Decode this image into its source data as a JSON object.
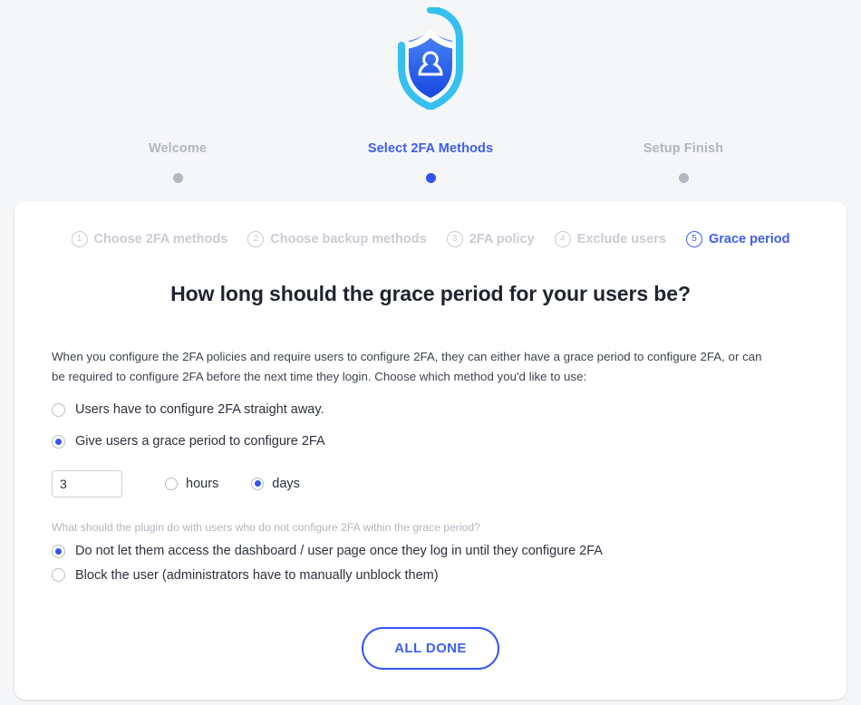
{
  "header": {
    "logo_icon": "shield-user-lock-icon",
    "logo_colors": {
      "outer": "#3ac6f0",
      "inner_top": "#3f7ef5",
      "inner_bottom": "#1e50e6"
    }
  },
  "wizard": {
    "steps": [
      {
        "label": "Welcome",
        "state": "done"
      },
      {
        "label": "Select 2FA Methods",
        "state": "active"
      },
      {
        "label": "Setup Finish",
        "state": "upcoming"
      }
    ],
    "active_color": "#3c5ef2",
    "inactive_color": "#b3b6bd"
  },
  "substeps": [
    {
      "num": "1",
      "label": "Choose 2FA methods",
      "current": false
    },
    {
      "num": "2",
      "label": "Choose backup methods",
      "current": false
    },
    {
      "num": "3",
      "label": "2FA policy",
      "current": false
    },
    {
      "num": "4",
      "label": "Exclude users",
      "current": false
    },
    {
      "num": "5",
      "label": "Grace period",
      "current": true
    }
  ],
  "main": {
    "heading": "How long should the grace period for your users be?",
    "intro": "When you configure the 2FA policies and require users to configure 2FA, they can either have a grace period to configure 2FA, or can be required to configure 2FA before the next time they login. Choose which method you'd like to use:",
    "grace_options": [
      {
        "label": "Users have to configure 2FA straight away.",
        "checked": false
      },
      {
        "label": "Give users a grace period to configure 2FA",
        "checked": true
      }
    ],
    "duration": {
      "value": "3",
      "placeholder": "",
      "units": [
        {
          "label": "hours",
          "checked": false
        },
        {
          "label": "days",
          "checked": true
        }
      ]
    },
    "helper_text": "What should the plugin do with users who do not configure 2FA within the grace period?",
    "enforcement_options": [
      {
        "label": "Do not let them access the dashboard / user page once they log in until they configure 2FA",
        "checked": true
      },
      {
        "label": "Block the user (administrators have to manually unblock them)",
        "checked": false
      }
    ],
    "submit_label": "ALL DONE"
  }
}
